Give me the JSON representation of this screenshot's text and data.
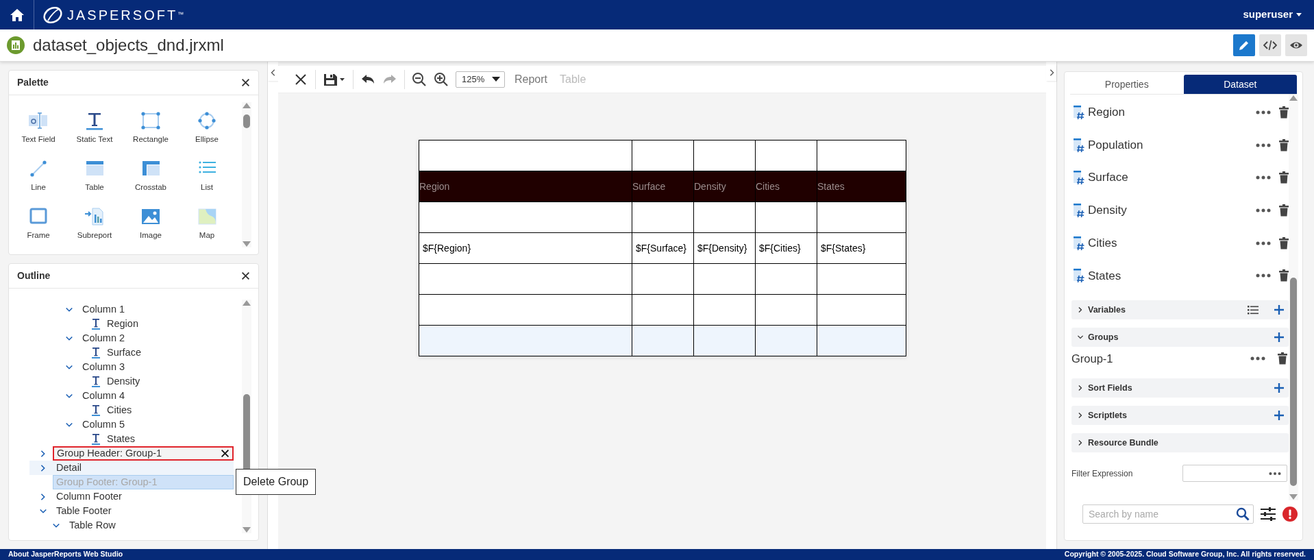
{
  "header": {
    "logo": "JASPERSOFT$^{™}$",
    "user": "superuser"
  },
  "document": {
    "title": "dataset_objects_dnd.jrxml",
    "modes": [
      {
        "kind": "edit",
        "selected": true
      },
      {
        "kind": "code",
        "selected": false
      },
      {
        "kind": "preview",
        "selected": false
      }
    ]
  },
  "palette": {
    "title": "Palette",
    "items": [
      {
        "kind": "text_field",
        "label": "Text Field"
      },
      {
        "kind": "static_text",
        "label": "Static Text"
      },
      {
        "kind": "rectangle",
        "label": "Rectangle"
      },
      {
        "kind": "ellipse",
        "label": "Ellipse"
      },
      {
        "kind": "line",
        "label": "Line"
      },
      {
        "kind": "table",
        "label": "Table"
      },
      {
        "kind": "crosstab",
        "label": "Crosstab"
      },
      {
        "kind": "list",
        "label": "List"
      },
      {
        "kind": "frame",
        "label": "Frame"
      },
      {
        "kind": "subreport",
        "label": "Subreport"
      },
      {
        "kind": "image",
        "label": "Image"
      },
      {
        "kind": "map",
        "label": "Map"
      }
    ]
  },
  "outline": {
    "title": "Outline",
    "tooltip": "Delete Group",
    "partial_branch": [
      {
        "kind": "band",
        "label": "Column 1",
        "expanded": true,
        "children": [
          {
            "kind": "text_element",
            "label": "Region"
          }
        ]
      },
      {
        "kind": "band",
        "label": "Column 2",
        "expanded": true,
        "children": [
          {
            "kind": "text_element",
            "label": "Surface"
          }
        ]
      },
      {
        "kind": "band",
        "label": "Column 3",
        "expanded": true,
        "children": [
          {
            "kind": "text_element",
            "label": "Density"
          }
        ]
      },
      {
        "kind": "band",
        "label": "Column 4",
        "expanded": true,
        "children": [
          {
            "kind": "text_element",
            "label": "Cities"
          }
        ]
      },
      {
        "kind": "band",
        "label": "Column 5",
        "expanded": true,
        "children": [
          {
            "kind": "text_element",
            "label": "States"
          }
        ]
      }
    ],
    "items": [
      {
        "kind": "band",
        "label": "Group Header: Group-1",
        "expanded": false,
        "hovered": true,
        "highlighted": false,
        "selected": false,
        "muted": false
      },
      {
        "kind": "band",
        "label": "Detail",
        "expanded": false,
        "hovered": false,
        "highlighted": true,
        "selected": false,
        "muted": false
      },
      {
        "kind": "band",
        "label": "Group Footer: Group-1",
        "hovered": false,
        "highlighted": false,
        "selected": true,
        "muted": true
      },
      {
        "kind": "band",
        "label": "Column Footer",
        "expanded": false,
        "hovered": false,
        "highlighted": false,
        "selected": false,
        "muted": false
      },
      {
        "kind": "band",
        "label": "Table Footer",
        "expanded": true,
        "hovered": false,
        "highlighted": false,
        "selected": false,
        "muted": false,
        "children": [
          {
            "kind": "band",
            "label": "Table Row",
            "expanded": true
          }
        ]
      }
    ]
  },
  "toolbar": {
    "undo": {
      "disabled": false
    },
    "redo": {
      "disabled": true
    },
    "zoom": "125%",
    "breadcrumb": [
      {
        "label": "Report",
        "selected": false
      },
      {
        "label": "Table",
        "selected": true
      }
    ]
  },
  "report_table": {
    "rows": [
      {
        "kind": "blank"
      },
      {
        "kind": "header",
        "cells": [
          "Region",
          "Surface",
          "Density",
          "Cities",
          "States"
        ]
      },
      {
        "kind": "blank"
      },
      {
        "kind": "detail",
        "cells": [
          "$F{Region}",
          "$F{Surface}",
          "$F{Density}",
          "$F{Cities}",
          "$F{States}"
        ]
      },
      {
        "kind": "blank"
      },
      {
        "kind": "blank"
      },
      {
        "kind": "footer"
      }
    ]
  },
  "side_panel": {
    "tabs": [
      {
        "label": "Properties",
        "selected": false
      },
      {
        "label": "Dataset",
        "selected": true
      }
    ],
    "fields": [
      {
        "label": "Region"
      },
      {
        "label": "Population"
      },
      {
        "label": "Surface"
      },
      {
        "label": "Density"
      },
      {
        "label": "Cities"
      },
      {
        "label": "States"
      }
    ],
    "sections": [
      {
        "label": "Variables",
        "expanded": false,
        "list_button": true,
        "add_button": true
      },
      {
        "label": "Groups",
        "expanded": true,
        "list_button": false,
        "add_button": true,
        "children": [
          {
            "label": "Group-1"
          }
        ]
      },
      {
        "label": "Sort Fields",
        "expanded": false,
        "list_button": false,
        "add_button": true
      },
      {
        "label": "Scriptlets",
        "expanded": false,
        "list_button": false,
        "add_button": true
      },
      {
        "label": "Resource Bundle",
        "expanded": false,
        "list_button": false,
        "add_button": false
      }
    ],
    "filter": {
      "label": "Filter Expression"
    },
    "search": {
      "placeholder": "Search by name"
    }
  },
  "footer": {
    "left": "About JasperReports Web Studio",
    "right": "Copyright © 2005-2025. Cloud Software Group, Inc. All rights reserved."
  }
}
